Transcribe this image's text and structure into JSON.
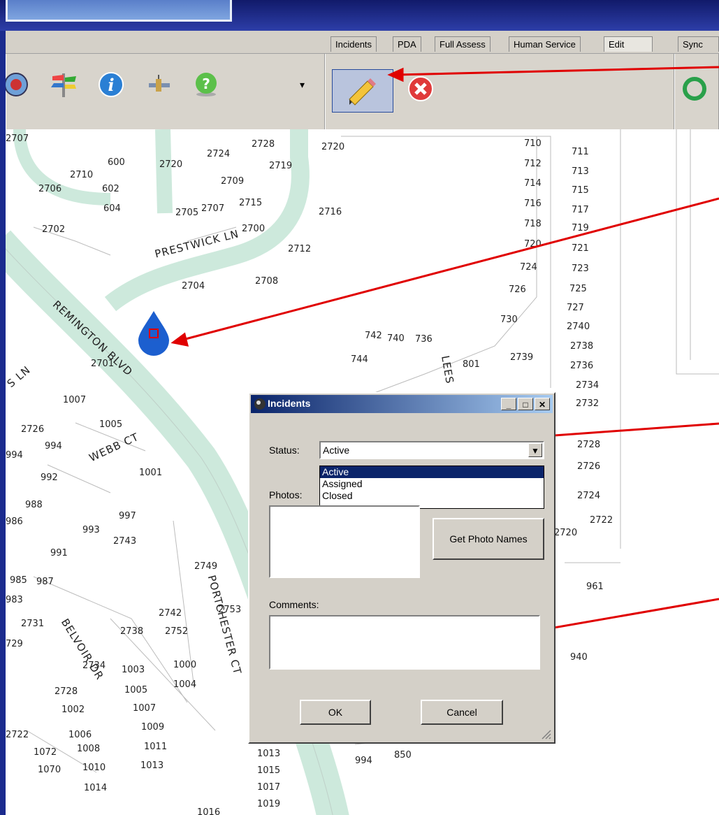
{
  "tabs": [
    {
      "label": "Incidents"
    },
    {
      "label": "PDA"
    },
    {
      "label": "Full Assess"
    },
    {
      "label": "Human Service"
    },
    {
      "label": "Edit"
    },
    {
      "label": "Sync"
    }
  ],
  "toolbar": {
    "icons": [
      "globe-icon",
      "signpost-icon",
      "info-icon",
      "satellite-icon",
      "help-icon",
      "dropdown-arrow-icon",
      "pencil-icon",
      "cancel-icon",
      "sync-icon"
    ],
    "dropdown_glyph": "▾"
  },
  "map": {
    "lots": [
      {
        "t": "2707"
      },
      {
        "t": "600"
      },
      {
        "t": "2720"
      },
      {
        "t": "2724"
      },
      {
        "t": "2728"
      },
      {
        "t": "2720"
      },
      {
        "t": "2719"
      },
      {
        "t": "2710"
      },
      {
        "t": "2709"
      },
      {
        "t": "2706"
      },
      {
        "t": "602"
      },
      {
        "t": "604"
      },
      {
        "t": "2705"
      },
      {
        "t": "2707"
      },
      {
        "t": "2715"
      },
      {
        "t": "2716"
      },
      {
        "t": "2702"
      },
      {
        "t": "2700"
      },
      {
        "t": "2712"
      },
      {
        "t": "2708"
      },
      {
        "t": "2704"
      },
      {
        "t": "2701"
      },
      {
        "t": "710"
      },
      {
        "t": "712"
      },
      {
        "t": "714"
      },
      {
        "t": "716"
      },
      {
        "t": "718"
      },
      {
        "t": "720"
      },
      {
        "t": "724"
      },
      {
        "t": "726"
      },
      {
        "t": "730"
      },
      {
        "t": "711"
      },
      {
        "t": "713"
      },
      {
        "t": "715"
      },
      {
        "t": "717"
      },
      {
        "t": "719"
      },
      {
        "t": "721"
      },
      {
        "t": "723"
      },
      {
        "t": "725"
      },
      {
        "t": "727"
      },
      {
        "t": "2740"
      },
      {
        "t": "2738"
      },
      {
        "t": "2736"
      },
      {
        "t": "2734"
      },
      {
        "t": "2732"
      },
      {
        "t": "2728"
      },
      {
        "t": "2726"
      },
      {
        "t": "2724"
      },
      {
        "t": "2722"
      },
      {
        "t": "2720"
      },
      {
        "t": "742"
      },
      {
        "t": "740"
      },
      {
        "t": "736"
      },
      {
        "t": "744"
      },
      {
        "t": "801"
      },
      {
        "t": "2739"
      },
      {
        "t": "1007"
      },
      {
        "t": "1005"
      },
      {
        "t": "2726"
      },
      {
        "t": "994"
      },
      {
        "t": "992"
      },
      {
        "t": "1001"
      },
      {
        "t": "988"
      },
      {
        "t": "986"
      },
      {
        "t": "997"
      },
      {
        "t": "993"
      },
      {
        "t": "2743"
      },
      {
        "t": "991"
      },
      {
        "t": "985"
      },
      {
        "t": "987"
      },
      {
        "t": "983"
      },
      {
        "t": "2749"
      },
      {
        "t": "2731"
      },
      {
        "t": "2742"
      },
      {
        "t": "2753"
      },
      {
        "t": "2738"
      },
      {
        "t": "2752"
      },
      {
        "t": "729"
      },
      {
        "t": "2734"
      },
      {
        "t": "1003"
      },
      {
        "t": "1000"
      },
      {
        "t": "2728"
      },
      {
        "t": "1005"
      },
      {
        "t": "1004"
      },
      {
        "t": "1002"
      },
      {
        "t": "1007"
      },
      {
        "t": "2722"
      },
      {
        "t": "1006"
      },
      {
        "t": "1009"
      },
      {
        "t": "1072"
      },
      {
        "t": "1008"
      },
      {
        "t": "1011"
      },
      {
        "t": "1070"
      },
      {
        "t": "1010"
      },
      {
        "t": "1013"
      },
      {
        "t": "1014"
      },
      {
        "t": "1013"
      },
      {
        "t": "1015"
      },
      {
        "t": "1017"
      },
      {
        "t": "1019"
      },
      {
        "t": "850"
      },
      {
        "t": "961"
      },
      {
        "t": "940"
      },
      {
        "t": "994"
      },
      {
        "t": "994"
      },
      {
        "t": "1016"
      }
    ],
    "streets": [
      {
        "t": "PRESTWICK LN"
      },
      {
        "t": "REMINGTON BLVD"
      },
      {
        "t": "S LN"
      },
      {
        "t": "WEBB CT"
      },
      {
        "t": "LEES"
      },
      {
        "t": "PORTCHESTER CT"
      },
      {
        "t": "BELVOIR DR"
      }
    ]
  },
  "dialog": {
    "title": "Incidents",
    "status_label": "Status:",
    "status_value": "Active",
    "status_options": [
      "Active",
      "Assigned",
      "Closed"
    ],
    "photos_label": "Photos:",
    "get_photos_label": "Get Photo Names",
    "comments_label": "Comments:",
    "ok_label": "OK",
    "cancel_label": "Cancel"
  },
  "colors": {
    "arrow": "#e00000",
    "road": "#cde9dc",
    "titlebar": "#0a246a",
    "marker": "#1c5fcf"
  }
}
